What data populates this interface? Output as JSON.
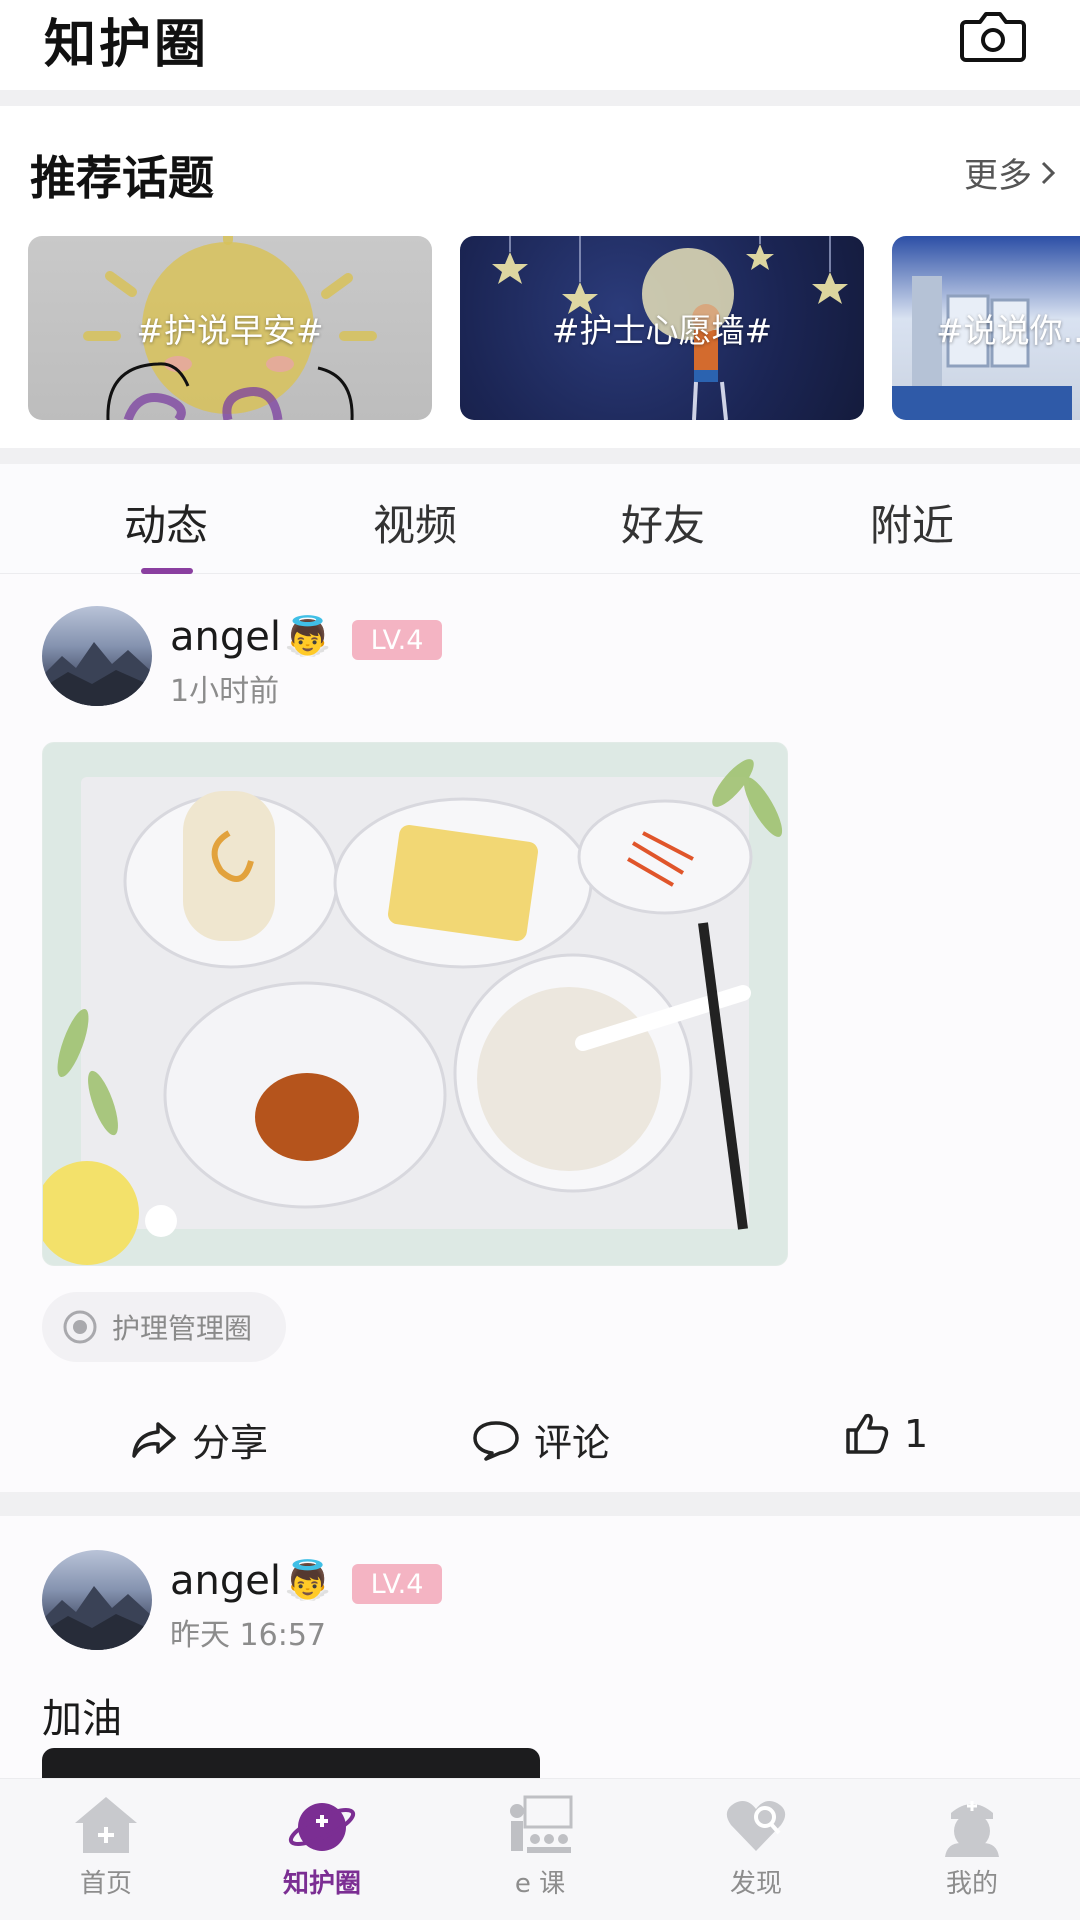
{
  "header": {
    "title": "知护圈"
  },
  "topics": {
    "section_title": "推荐话题",
    "more_label": "更多",
    "cards": [
      {
        "label": "#护说早安#"
      },
      {
        "label": "#护士心愿墙#"
      },
      {
        "label": "#说说你..."
      }
    ]
  },
  "tabs": [
    {
      "label": "动态",
      "active": true
    },
    {
      "label": "视频"
    },
    {
      "label": "好友"
    },
    {
      "label": "附近"
    }
  ],
  "posts": [
    {
      "username": "angel",
      "badge": "👼",
      "level": "LV.4",
      "time": "1小时前",
      "circle": "护理管理圈",
      "actions": {
        "share": "分享",
        "comment": "评论",
        "like_count": "1"
      }
    },
    {
      "username": "angel",
      "badge": "👼",
      "level": "LV.4",
      "time": "昨天 16:57",
      "text": "加油"
    }
  ],
  "bottom_nav": [
    {
      "label": "首页"
    },
    {
      "label": "知护圈",
      "active": true
    },
    {
      "label": "e 课"
    },
    {
      "label": "发现"
    },
    {
      "label": "我的"
    }
  ],
  "colors": {
    "accent": "#7b2e93",
    "level_badge": "#f4b4c3",
    "nav_inactive": "#8d8d8d"
  }
}
